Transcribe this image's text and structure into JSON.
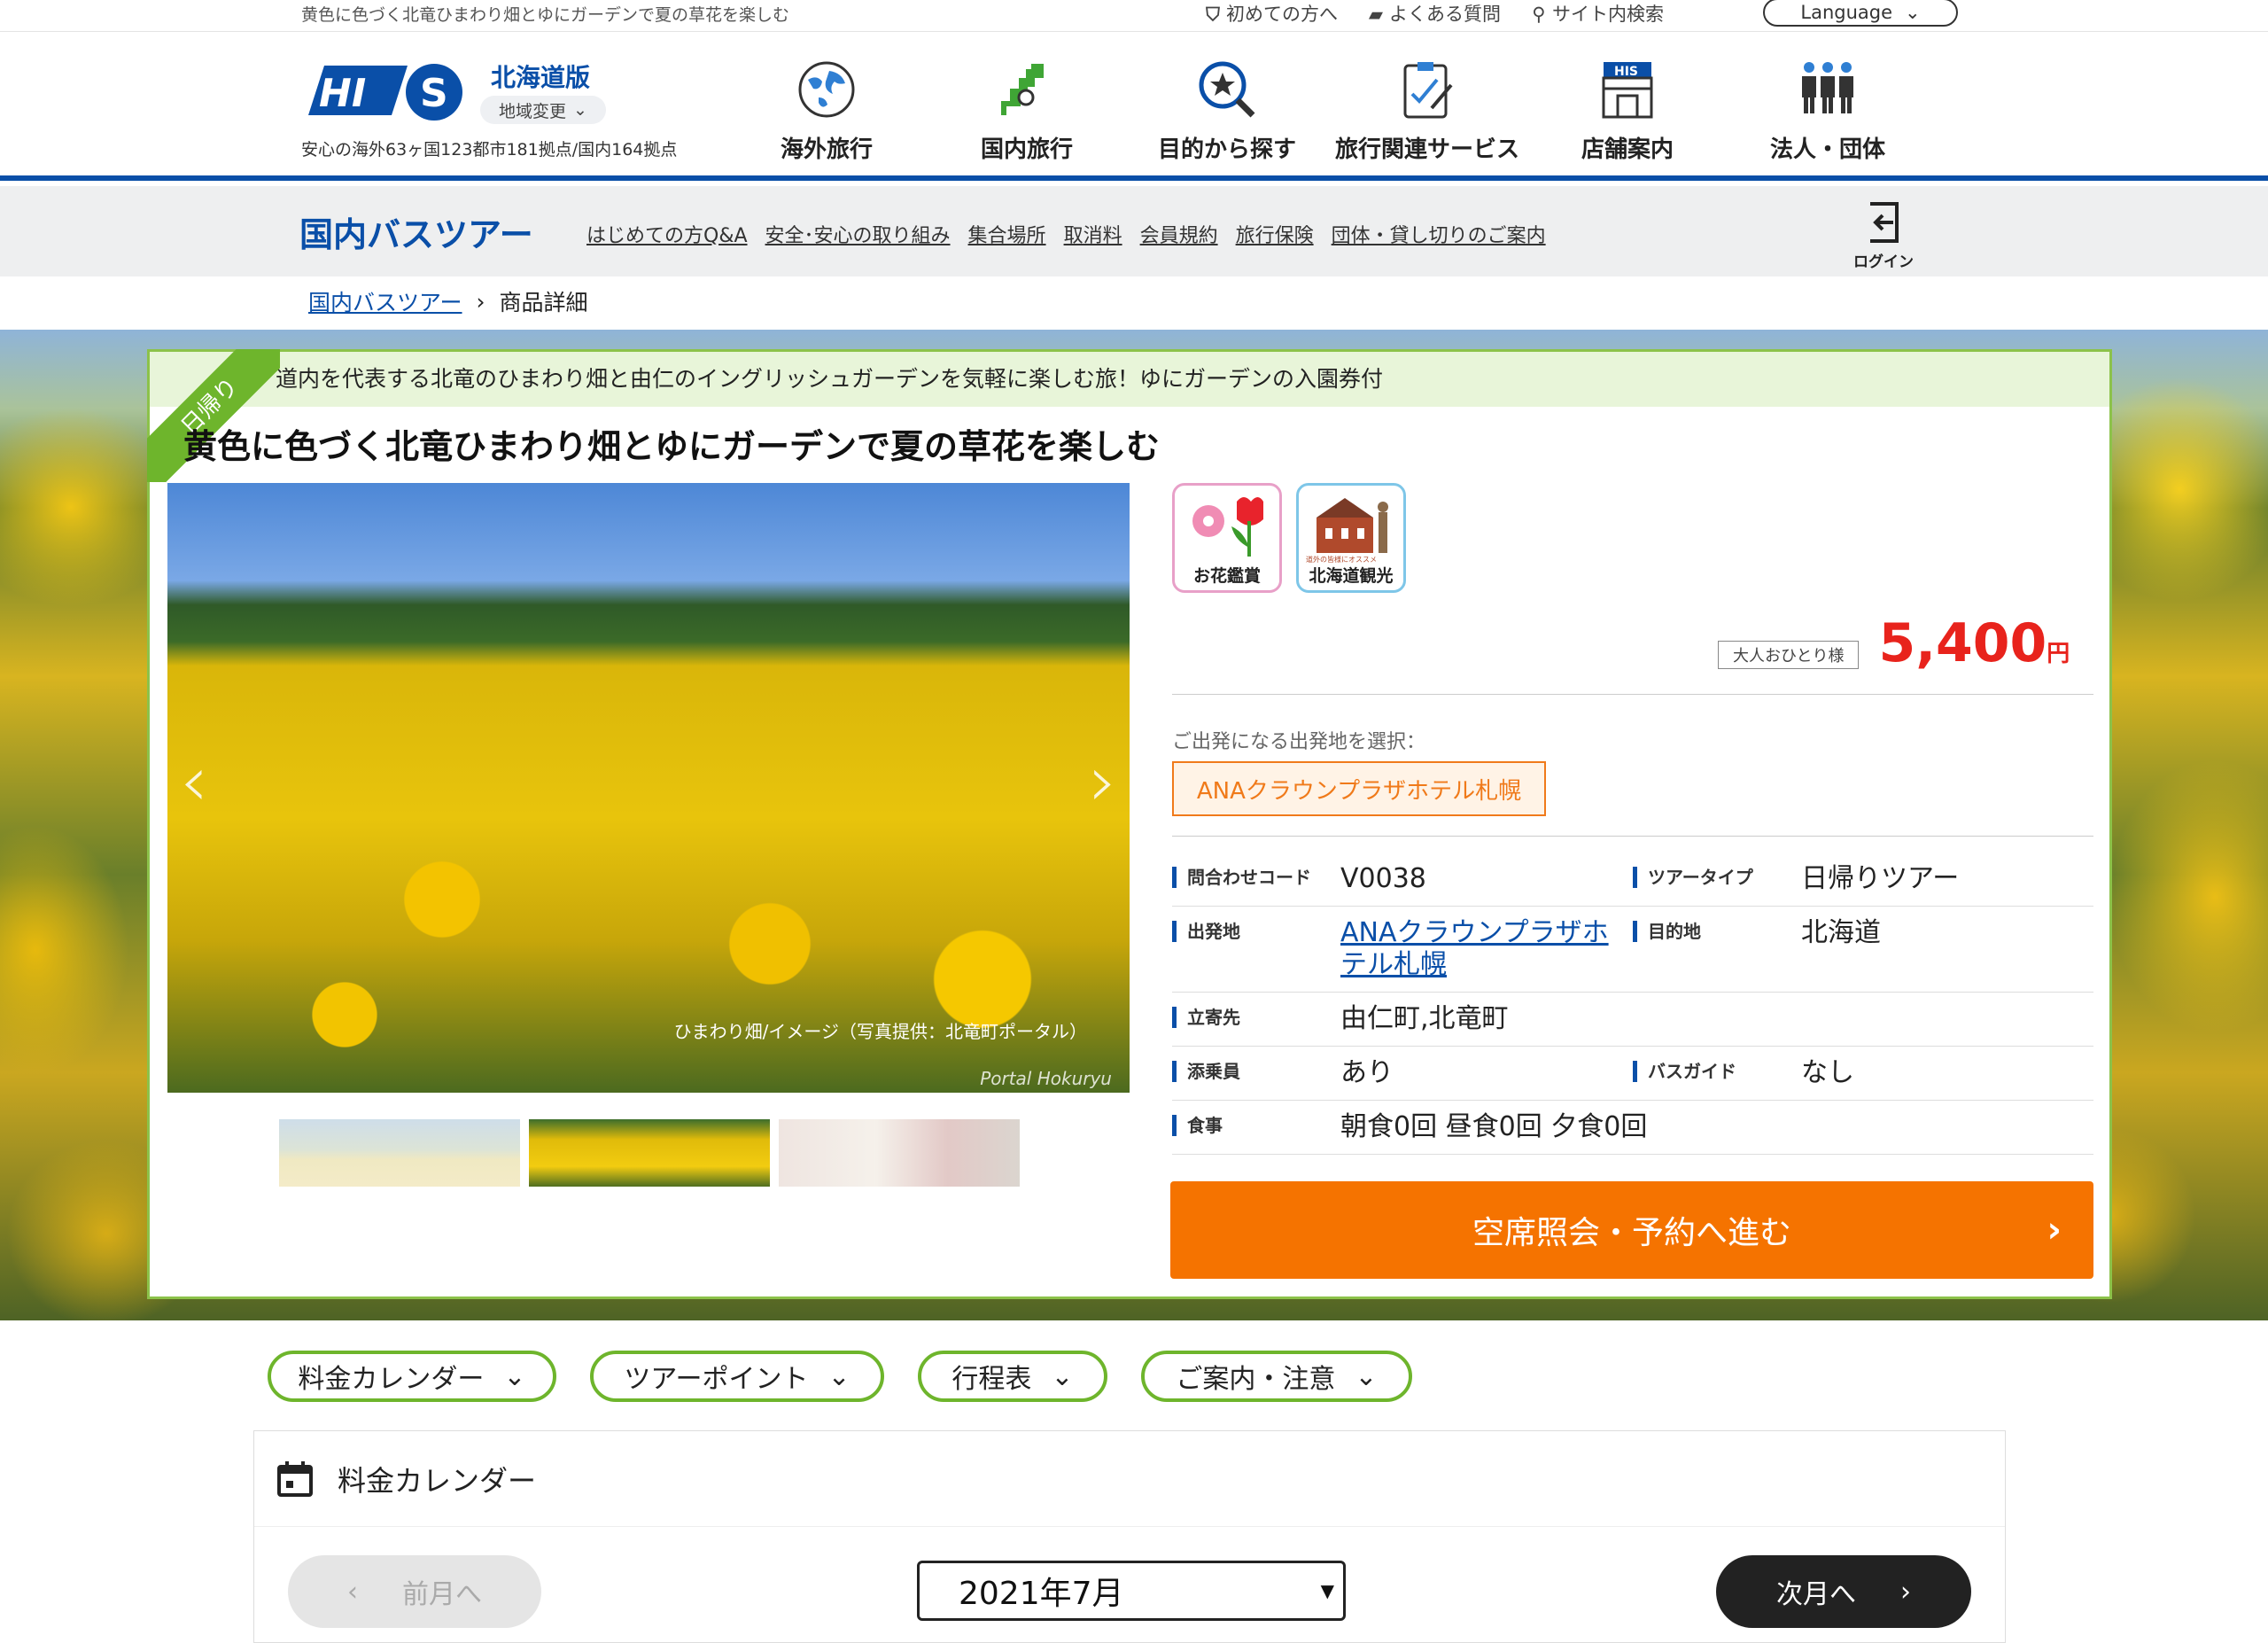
{
  "util": {
    "page_title": "黄色に色づく北竜ひまわり畑とゆにガーデンで夏の草花を楽しむ",
    "links": [
      "初めての方へ",
      "よくある質問",
      "サイト内検索"
    ],
    "language": "Language"
  },
  "header": {
    "region": "北海道版",
    "region_change": "地域変更",
    "tagline": "安心の海外63ヶ国123都市181拠点/国内164拠点",
    "nav": [
      "海外旅行",
      "国内旅行",
      "目的から探す",
      "旅行関連サービス",
      "店舗案内",
      "法人・団体"
    ]
  },
  "subnav": {
    "title": "国内バスツアー",
    "links": [
      "はじめての方Q&A",
      "安全･安心の取り組み",
      "集合場所",
      "取消料",
      "会員規約",
      "旅行保険",
      "団体・貸し切りのご案内"
    ],
    "login": "ログイン"
  },
  "breadcrumb": {
    "home": "国内バスツアー",
    "current": "商品詳細"
  },
  "tour": {
    "ribbon": "日帰り",
    "banner": "道内を代表する北竜のひまわり畑と由仁のイングリッシュガーデンを気軽に楽しむ旅！ゆにガーデンの入園券付",
    "title": "黄色に色づく北竜ひまわり畑とゆにガーデンで夏の草花を楽しむ",
    "photo_caption": "ひまわり畑/イメージ（写真提供：北竜町ポータル）",
    "photo_signature": "Portal Hokuryu",
    "badges": [
      "お花鑑賞",
      "北海道観光"
    ],
    "badge_sub": "道外の皆様にオススメ",
    "price_per": "大人おひとり様",
    "price": "5,400",
    "price_unit": "円",
    "departure_label": "ご出発になる出発地を選択：",
    "departure": "ANAクラウンプラザホテル札幌",
    "info": {
      "code_k": "問合わせコード",
      "code_v": "V0038",
      "type_k": "ツアータイプ",
      "type_v": "日帰りツアー",
      "from_k": "出発地",
      "from_v": "ANAクラウンプラザホテル札幌",
      "dest_k": "目的地",
      "dest_v": "北海道",
      "stop_k": "立寄先",
      "stop_v": "由仁町,北竜町",
      "conductor_k": "添乗員",
      "conductor_v": "あり",
      "guide_k": "バスガイド",
      "guide_v": "なし",
      "meal_k": "食事",
      "meal_v": "朝食0回 昼食0回 夕食0回"
    },
    "cta": "空席照会・予約へ進む"
  },
  "tabs": [
    "料金カレンダー",
    "ツアーポイント",
    "行程表",
    "ご案内・注意"
  ],
  "calendar": {
    "title": "料金カレンダー",
    "prev": "前月へ",
    "month": "2021年7月",
    "next": "次月へ"
  }
}
